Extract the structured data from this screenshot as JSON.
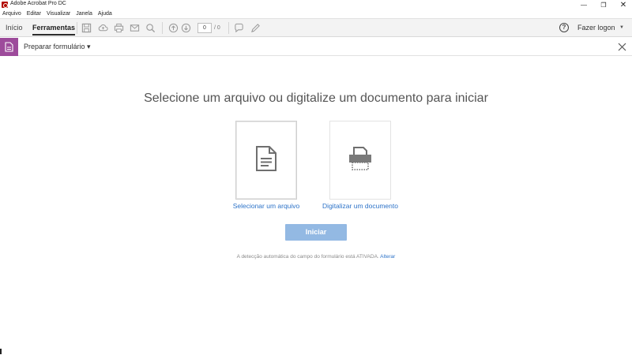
{
  "window": {
    "title": "Adobe Acrobat Pro DC",
    "controls": {
      "minimize": "—",
      "maximize": "❐",
      "close": "✕"
    }
  },
  "menu": [
    "Arquivo",
    "Editar",
    "Visualizar",
    "Janela",
    "Ajuda"
  ],
  "toolbar": {
    "tabs": [
      {
        "label": "Início",
        "active": false
      },
      {
        "label": "Ferramentas",
        "active": true
      }
    ],
    "icons": [
      "save-icon",
      "cloud-upload-icon",
      "print-icon",
      "mail-icon",
      "search-icon",
      "page-up-icon",
      "page-down-icon",
      "comment-icon",
      "pen-icon"
    ],
    "page_current": "0",
    "page_total": "/ 0",
    "help": "?",
    "login_label": "Fazer logon",
    "login_caret": "▼"
  },
  "tool": {
    "label": "Preparar formulário",
    "caret": "▾",
    "accent_color": "#9d4b9b"
  },
  "main": {
    "heading": "Selecione um arquivo ou digitalize um documento para iniciar",
    "select_file_label": "Selecionar um arquivo",
    "scan_label": "Digitalizar um documento",
    "start_label": "Iniciar",
    "notice_text": "A detecção automática do campo do formulário está ATIVADA.",
    "notice_link": "Alterar"
  },
  "colors": {
    "link": "#2d73c8",
    "start_button": "#93b9e3"
  }
}
